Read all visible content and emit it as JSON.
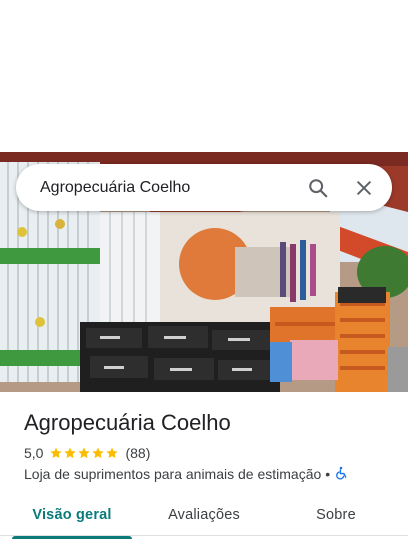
{
  "search": {
    "query": "Agropecuária Coelho",
    "search_icon": "search-icon",
    "close_icon": "close-icon"
  },
  "place": {
    "photo": "storefront-photo",
    "title": "Agropecuária Coelho",
    "rating": "5,0",
    "stars": 5,
    "review_count": "(88)",
    "category": "Loja de suprimentos para animais de estimação",
    "separator": "•",
    "accessibility_icon": "wheelchair-icon"
  },
  "tabs": [
    {
      "label": "Visão geral",
      "active": true
    },
    {
      "label": "Avaliações",
      "active": false
    },
    {
      "label": "Sobre",
      "active": false
    }
  ],
  "colors": {
    "accent": "#0b7a7a",
    "star": "#fbbc04",
    "accessibility": "#1a73e8"
  }
}
